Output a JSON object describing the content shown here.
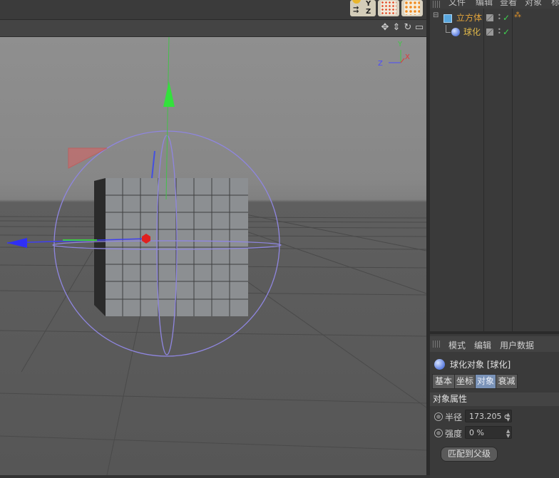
{
  "toolbar": {
    "coord_axes": [
      "Y",
      "Z"
    ],
    "coord_icon": "coordinate-system-icon",
    "mesh_icons": [
      "mesh-checker-icon",
      "mesh-dots-icon"
    ]
  },
  "viewport": {
    "header_icons": [
      "move-view-icon",
      "zoom-view-icon",
      "rotate-view-icon",
      "layout-icon"
    ],
    "axis_gizmo": {
      "y": "Y",
      "x": "X",
      "z": "Z"
    }
  },
  "object_manager": {
    "menu": [
      "文件",
      "编辑",
      "查看",
      "对象",
      "标"
    ],
    "objects": [
      {
        "name": "立方体",
        "icon": "cube-icon",
        "color": "#e0a23a"
      },
      {
        "name": "球化",
        "icon": "sphere-icon",
        "color": "#e0b84a"
      }
    ]
  },
  "attribute_manager": {
    "menu": [
      "模式",
      "编辑",
      "用户数据"
    ],
    "title": "球化对象 [球化]",
    "tabs": [
      "基本",
      "坐标",
      "对象",
      "衰减"
    ],
    "active_tab": "对象",
    "section": "对象属性",
    "fields": [
      {
        "label": "半径",
        "value": "173.205 c"
      },
      {
        "label": "强度",
        "value": "0 %"
      }
    ],
    "button": "匹配到父级"
  }
}
